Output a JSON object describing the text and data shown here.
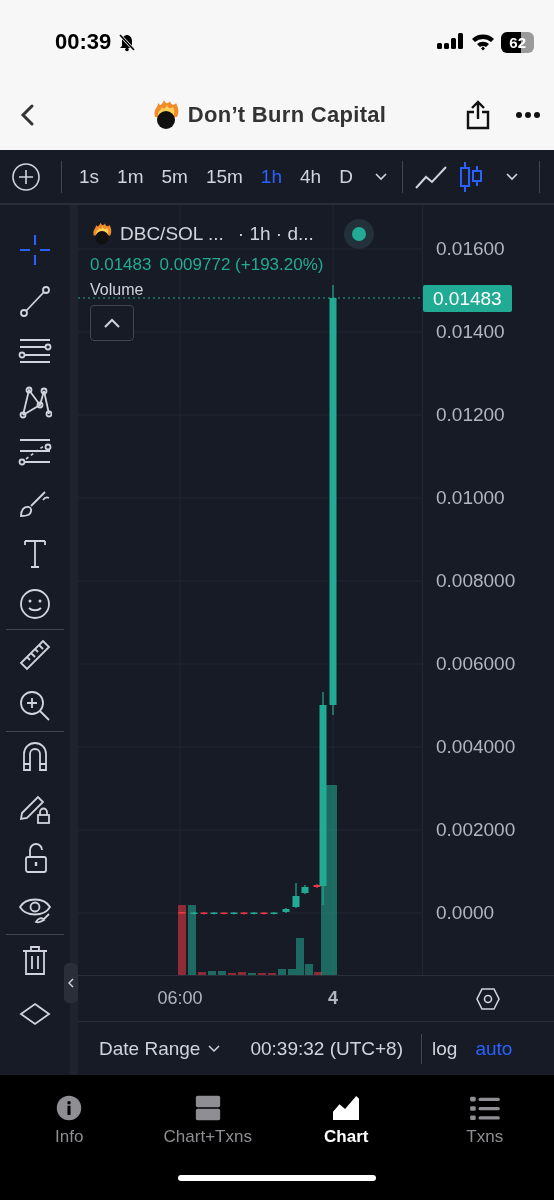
{
  "status_bar": {
    "time": "00:39",
    "battery": "62"
  },
  "header": {
    "title": "Don’t Burn Capital"
  },
  "toolbar": {
    "intervals": [
      {
        "label": "1s",
        "selected": false
      },
      {
        "label": "1m",
        "selected": false
      },
      {
        "label": "5m",
        "selected": false
      },
      {
        "label": "15m",
        "selected": false
      },
      {
        "label": "1h",
        "selected": true
      },
      {
        "label": "4h",
        "selected": false
      },
      {
        "label": "D",
        "selected": false
      }
    ],
    "chart_types": [
      {
        "kind": "line",
        "selected": false
      },
      {
        "kind": "candles",
        "selected": true
      }
    ]
  },
  "tool_groups": [
    {
      "tools": [
        {
          "kind": "crosshair",
          "selected": true
        },
        {
          "kind": "trend-line",
          "selected": false
        },
        {
          "kind": "parallel-lines",
          "selected": false
        },
        {
          "kind": "pattern",
          "selected": false
        },
        {
          "kind": "fib",
          "selected": false
        },
        {
          "kind": "brush",
          "selected": false
        },
        {
          "kind": "text",
          "selected": false
        },
        {
          "kind": "emoji",
          "selected": false
        }
      ]
    },
    {
      "tools": [
        {
          "kind": "ruler",
          "selected": false
        },
        {
          "kind": "zoom",
          "selected": false
        }
      ]
    },
    {
      "tools": [
        {
          "kind": "magnet",
          "selected": false
        },
        {
          "kind": "pencil-lock",
          "selected": false
        },
        {
          "kind": "lock",
          "selected": false
        },
        {
          "kind": "eye",
          "selected": false
        }
      ]
    },
    {
      "tools": [
        {
          "kind": "trash",
          "selected": false
        },
        {
          "kind": "diamond",
          "selected": false
        }
      ]
    }
  ],
  "legend": {
    "symbol": "DBC/SOL ...",
    "interval": "· 1h · d...",
    "last": "0.01483",
    "change": "0.009772 (+193.20%)",
    "volume_label": "Volume"
  },
  "price_axis": {
    "ticks": [
      "0.01600",
      "0.01400",
      "0.01200",
      "0.01000",
      "0.008000",
      "0.006000",
      "0.004000",
      "0.002000",
      "0.0000"
    ],
    "current_price": "0.01483"
  },
  "time_axis": {
    "ticks": [
      {
        "label": "06:00",
        "kind": "time"
      },
      {
        "label": "4",
        "kind": "day"
      }
    ]
  },
  "footer": {
    "date_range": "Date Range",
    "time": "00:39:32 (UTC+8)",
    "log": {
      "label": "log",
      "on": false
    },
    "auto": {
      "label": "auto",
      "on": true
    }
  },
  "tabs": [
    {
      "label": "Info",
      "kind": "info",
      "selected": false
    },
    {
      "label": "Chart+Txns",
      "kind": "split",
      "selected": false
    },
    {
      "label": "Chart",
      "kind": "chart",
      "selected": true
    },
    {
      "label": "Txns",
      "kind": "list",
      "selected": false
    }
  ]
}
